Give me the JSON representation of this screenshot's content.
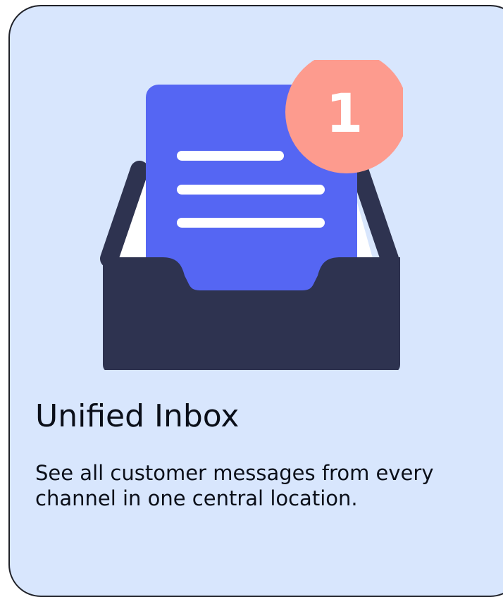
{
  "feature": {
    "title": "Unified Inbox",
    "description": "See all customer messages from every channel in one central location.",
    "notification_count": "1",
    "icon": "inbox-tray-icon"
  },
  "colors": {
    "card_background": "#d8e6fd",
    "tray": "#2e3350",
    "document": "#5566f3",
    "badge": "#fd9b8e",
    "text": "#0b0f19"
  }
}
